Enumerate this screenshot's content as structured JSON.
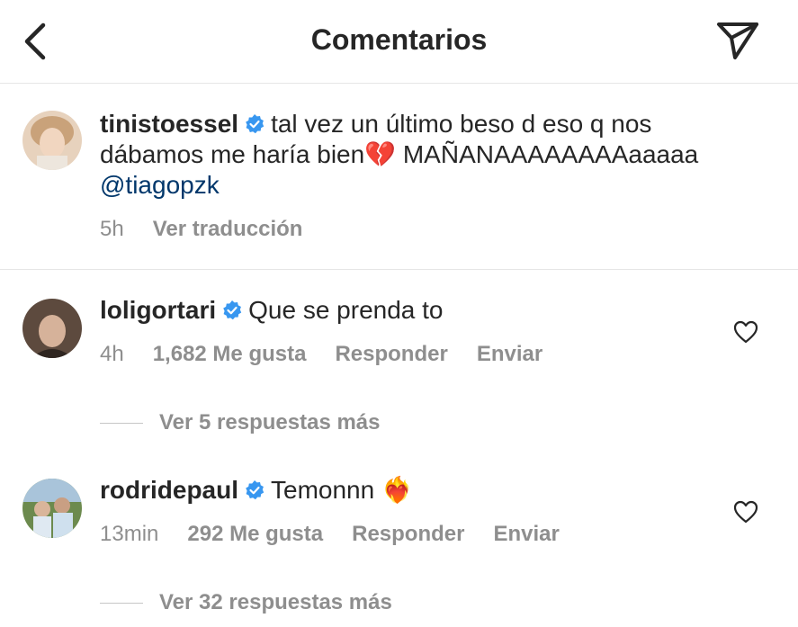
{
  "header": {
    "title": "Comentarios",
    "back_icon": "chevron-left-icon",
    "send_icon": "paper-plane-icon"
  },
  "caption": {
    "username": "tinistoessel",
    "text_part1": "tal vez un último beso d eso q nos dábamos me haría bien",
    "emoji": "💔",
    "text_part2": " MAÑANAAAAAAAAaaaaa",
    "mention": "@tiagopzk",
    "time": "5h",
    "translate": "Ver traducción"
  },
  "comments": [
    {
      "username": "loligortari",
      "text": "Que se prenda to",
      "time": "4h",
      "likes": "1,682 Me gusta",
      "reply": "Responder",
      "send": "Enviar",
      "view_replies": "Ver 5 respuestas más"
    },
    {
      "username": "rodridepaul",
      "text": "Temonnn",
      "emoji": "❤️‍🔥",
      "time": "13min",
      "likes": "292 Me gusta",
      "reply": "Responder",
      "send": "Enviar",
      "view_replies": "Ver 32 respuestas más"
    }
  ],
  "colors": {
    "verified": "#3897f0",
    "mention": "#00376b",
    "meta": "#8e8e8e",
    "text": "#262626"
  }
}
